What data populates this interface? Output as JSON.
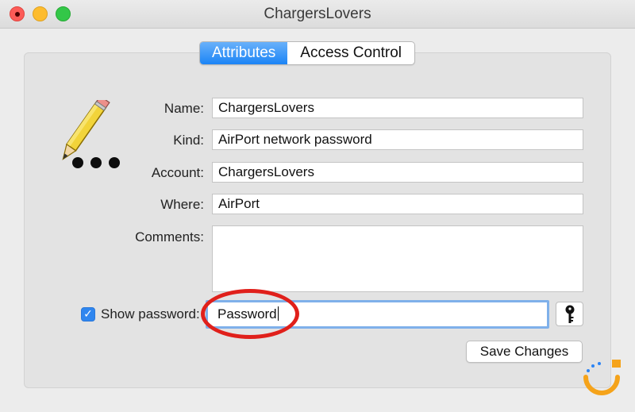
{
  "window": {
    "title": "ChargersLovers"
  },
  "tabs": [
    {
      "label": "Attributes",
      "active": true
    },
    {
      "label": "Access Control",
      "active": false
    }
  ],
  "form": {
    "name_label": "Name:",
    "name_value": "ChargersLovers",
    "kind_label": "Kind:",
    "kind_value": "AirPort network password",
    "account_label": "Account:",
    "account_value": "ChargersLovers",
    "where_label": "Where:",
    "where_value": "AirPort",
    "comments_label": "Comments:",
    "comments_value": "",
    "show_password_label": "Show password:",
    "show_password_checked": true,
    "password_value": "Password",
    "save_label": "Save Changes"
  },
  "icons": {
    "document_icon": "pencil-with-dots-icon",
    "key_icon": "key-icon",
    "brand_logo": "brand-logo"
  },
  "colors": {
    "tab_active": "#1b84f6",
    "highlight_circle": "#e0201b",
    "checkbox": "#2f86ef",
    "focus_ring": "#7fb0ea"
  }
}
